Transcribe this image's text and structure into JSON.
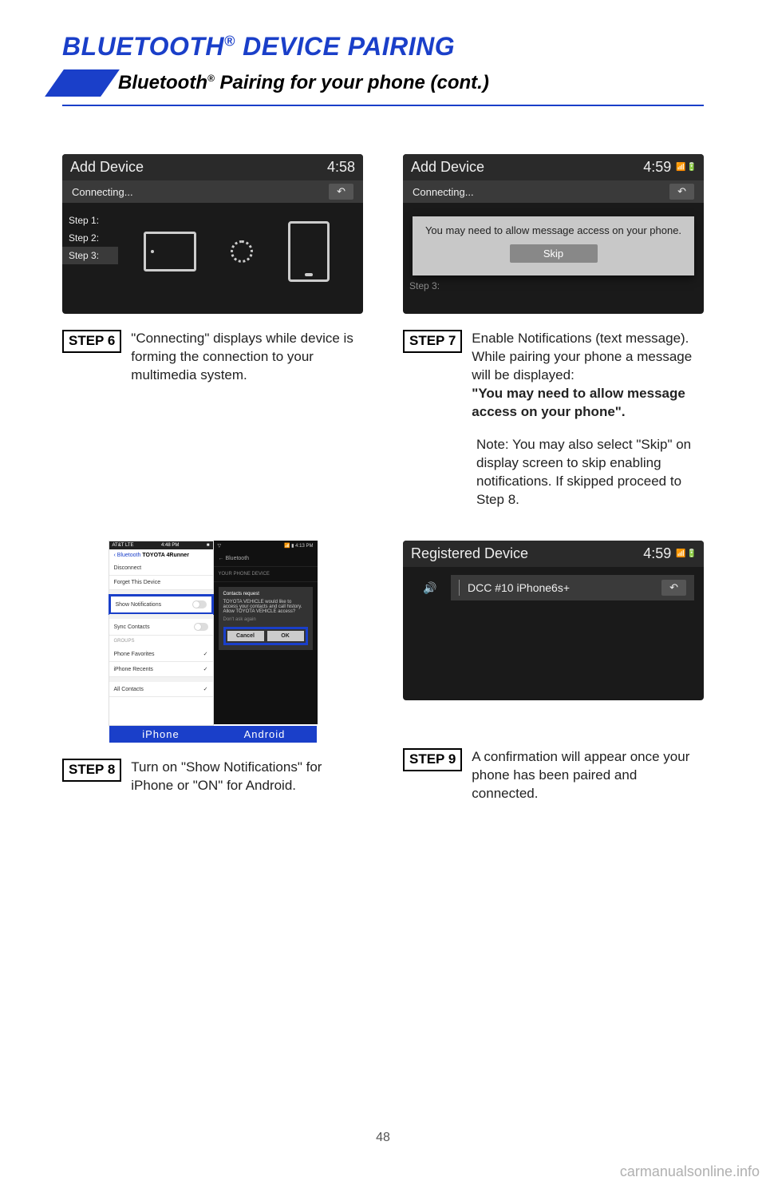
{
  "header": {
    "section_title_pre": "BLUETOOTH",
    "section_title_reg": "®",
    "section_title_post": " DEVICE PAIRING",
    "subtitle_pre": "Bluetooth",
    "subtitle_reg": "®",
    "subtitle_post": " Pairing for your phone (cont.)"
  },
  "screens": {
    "s6": {
      "title": "Add Device",
      "time": "4:58",
      "status": "Connecting...",
      "steps": [
        "Step 1:",
        "Step 2:",
        "Step 3:"
      ]
    },
    "s7": {
      "title": "Add Device",
      "time": "4:59",
      "status": "Connecting...",
      "popup_msg": "You may need to allow message access on your phone.",
      "popup_btn": "Skip",
      "faded": "Step 3:"
    },
    "s9": {
      "title": "Registered Device",
      "time": "4:59",
      "device": "DCC #10 iPhone6s+"
    }
  },
  "ios": {
    "carrier": "AT&T  LTE",
    "time": "4:48 PM",
    "back": "Bluetooth",
    "name": "TOYOTA 4Runner",
    "rows": {
      "disconnect": "Disconnect",
      "forget": "Forget This Device",
      "shownotif": "Show Notifications",
      "sync": "Sync Contacts"
    },
    "groups": "GROUPS",
    "fav": "Phone Favorites",
    "recents": "iPhone Recents",
    "all": "All Contacts"
  },
  "android": {
    "time": "4:13 PM",
    "bt": "Bluetooth",
    "section": "YOUR PHONE DEVICE",
    "dlg_title": "Contacts request",
    "dlg_body": "TOYOTA VEHICLE would like to access your contacts and call history. Allow TOYOTA VEHICLE access?",
    "dlg_check": "Don't ask again",
    "cancel": "Cancel",
    "ok": "OK"
  },
  "os_labels": {
    "ios": "iPhone",
    "and": "Android"
  },
  "steps": {
    "s6": {
      "label": "STEP 6",
      "text": "\"Connecting\" displays while device is forming the connection to your multimedia system."
    },
    "s7": {
      "label": "STEP 7",
      "text1": "Enable Notifications (text message). While pairing your phone a message will be displayed:",
      "bold": "\"You may need to allow message access on your phone\".",
      "note_pre": "Note: You may also select \"Skip\" on display screen to skip enabling notifications. If skipped proceed to ",
      "note_link": "Step 8",
      "note_post": "."
    },
    "s8": {
      "label": "STEP 8",
      "text": "Turn on \"Show Notifications\" for iPhone or \"ON\" for Android."
    },
    "s9": {
      "label": "STEP 9",
      "text": "A confirmation will appear once your phone has been paired and connected."
    }
  },
  "footer": {
    "page": "48",
    "watermark": "carmanualsonline.info"
  }
}
